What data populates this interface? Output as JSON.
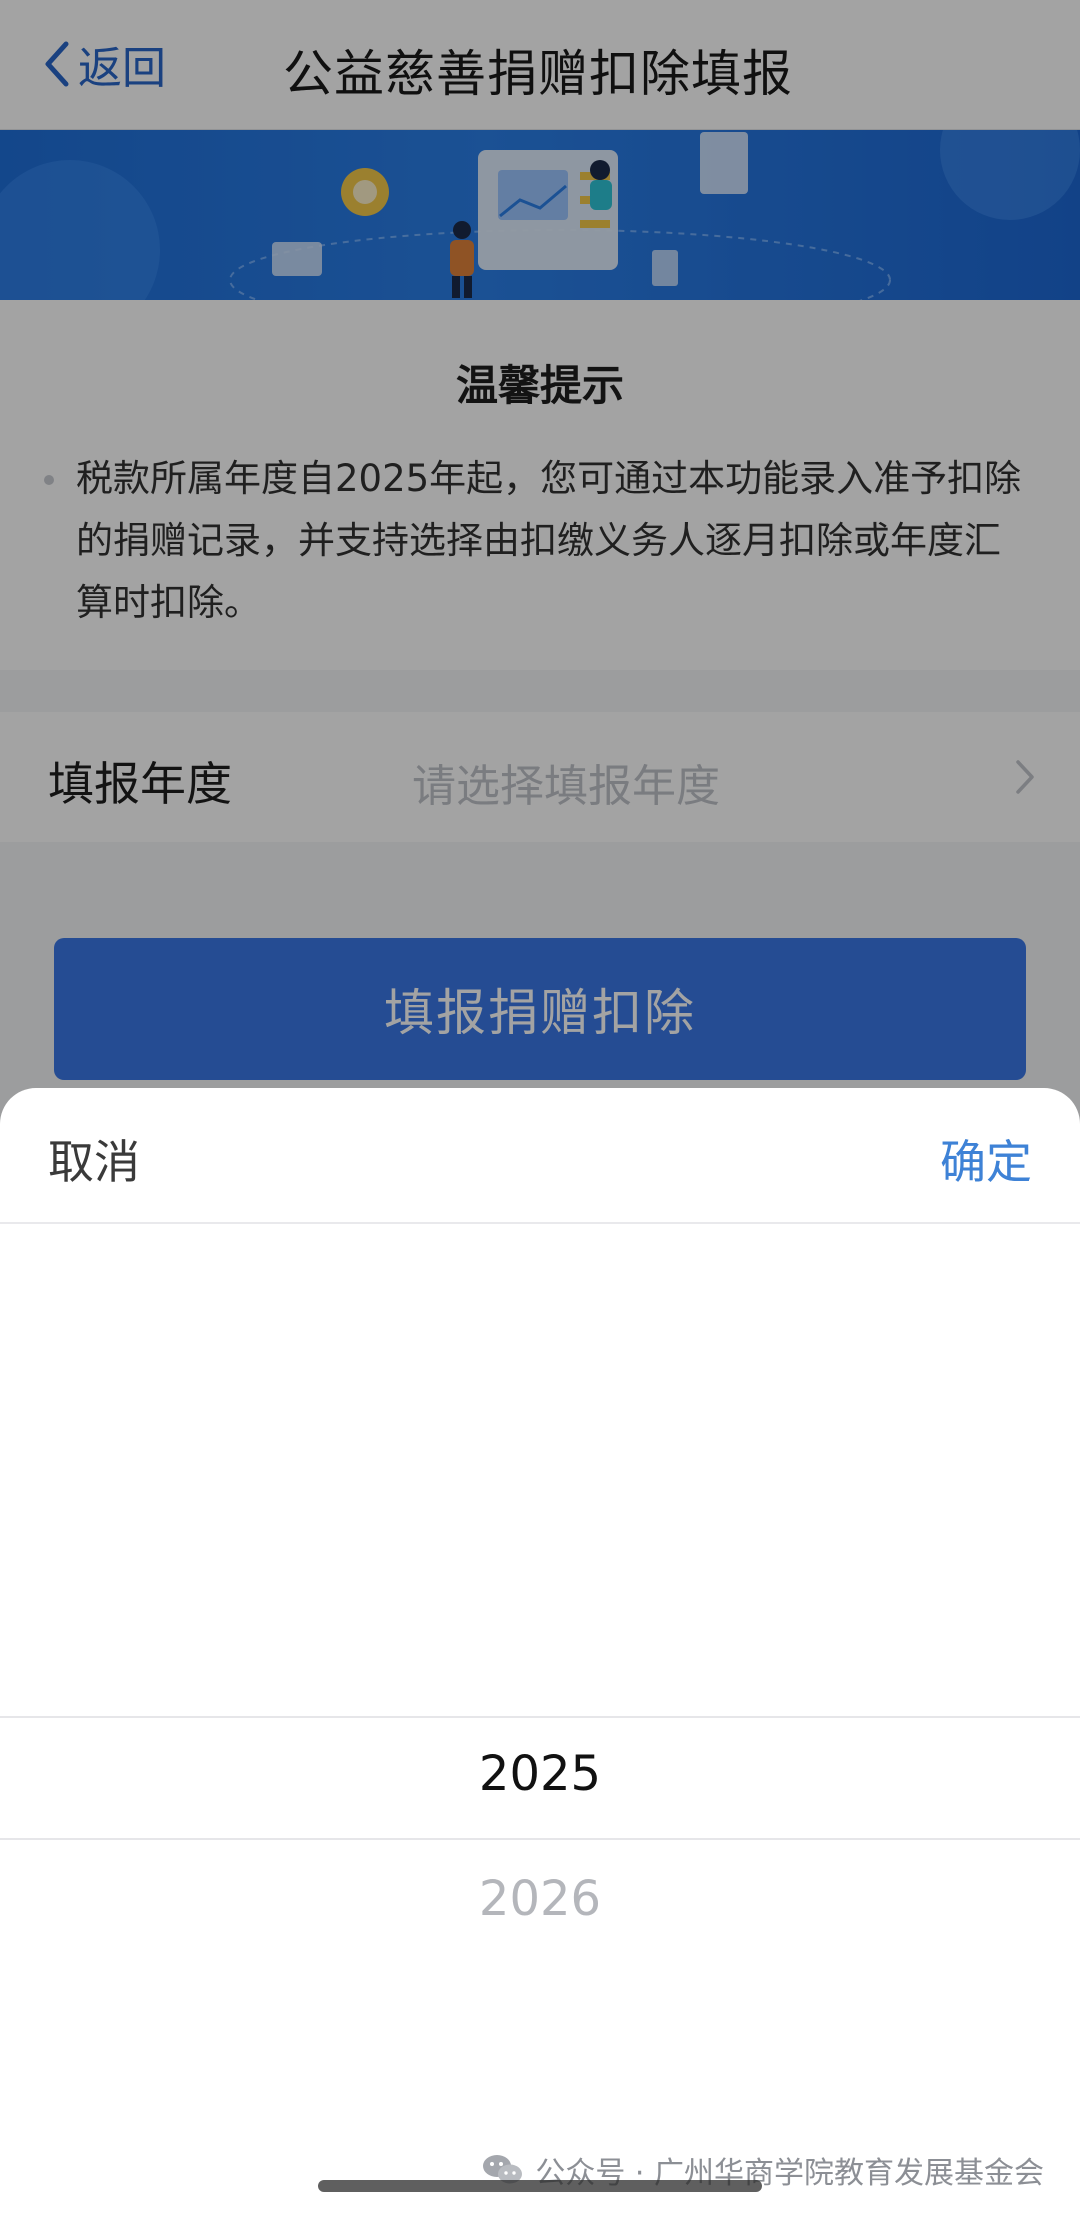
{
  "nav": {
    "back_label": "返回",
    "title": "公益慈善捐赠扣除填报"
  },
  "notice": {
    "title": "温馨提示",
    "text": "税款所属年度自2025年起，您可通过本功能录入准予扣除的捐赠记录，并支持选择由扣缴义务人逐月扣除或年度汇算时扣除。"
  },
  "form": {
    "year_label": "填报年度",
    "year_placeholder": "请选择填报年度",
    "submit_label": "填报捐赠扣除"
  },
  "picker": {
    "cancel_label": "取消",
    "confirm_label": "确定",
    "options": [
      "2025",
      "2026"
    ],
    "selected": "2025"
  },
  "watermark": {
    "text": "公众号 · 广州华商学院教育发展基金会"
  },
  "colors": {
    "accent": "#3a78e6",
    "confirm": "#3e82d6",
    "banner": "#2b7fe8"
  }
}
